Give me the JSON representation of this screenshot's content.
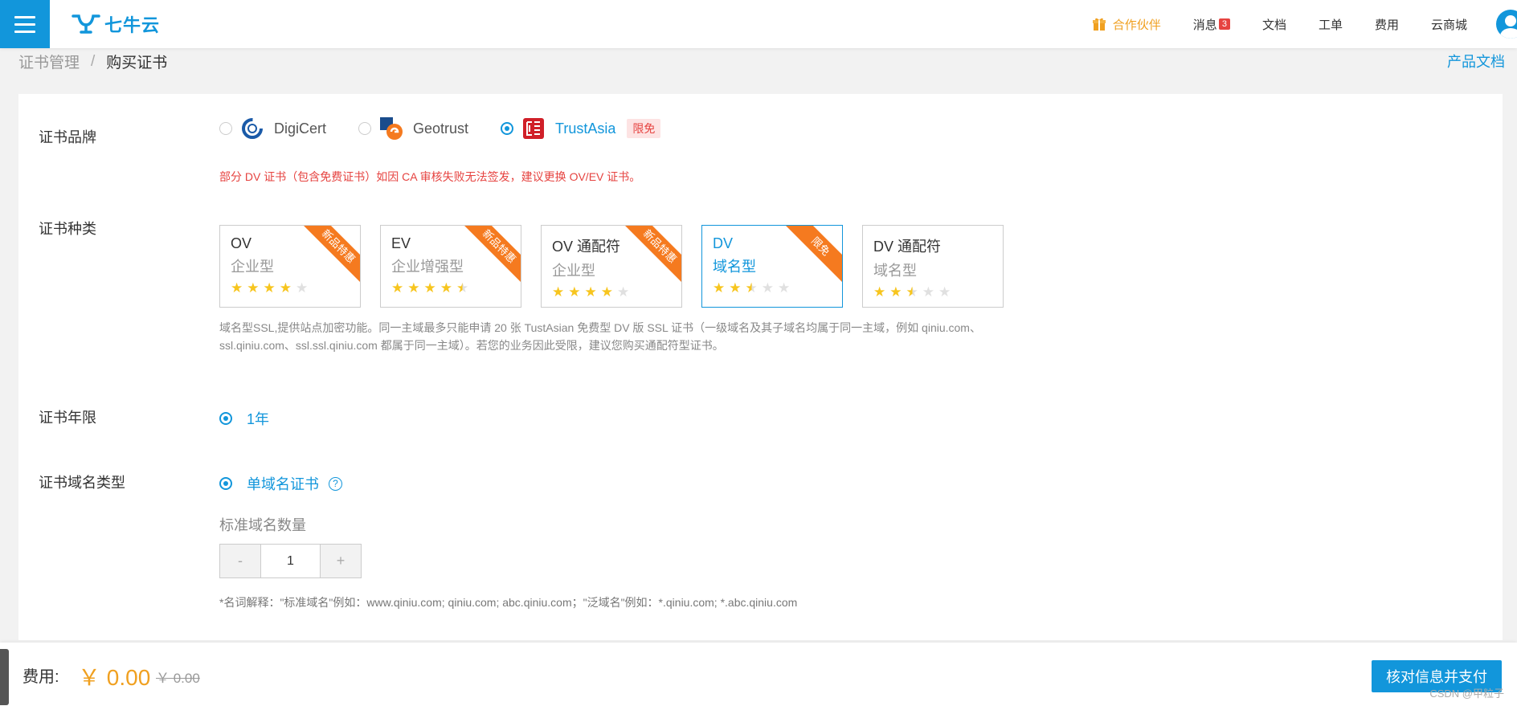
{
  "header": {
    "logo_text": "七牛云",
    "nav": {
      "partner": "合作伙伴",
      "messages": "消息",
      "messages_count": "3",
      "docs": "文档",
      "tickets": "工单",
      "billing": "费用",
      "market": "云商城"
    }
  },
  "breadcrumb": {
    "parent": "证书管理",
    "separator": "/",
    "current": "购买证书"
  },
  "product_doc_link": "产品文档",
  "form": {
    "brand": {
      "label": "证书品牌",
      "options": [
        {
          "name": "DigiCert",
          "selected": false
        },
        {
          "name": "Geotrust",
          "selected": false
        },
        {
          "name": "TrustAsia",
          "selected": true,
          "tag": "限免"
        }
      ],
      "warning": "部分 DV 证书（包含免费证书）如因 CA 审核失败无法签发，建议更换 OV/EV 证书。"
    },
    "type": {
      "label": "证书种类",
      "options": [
        {
          "name": "OV",
          "sub": "企业型",
          "ribbon": "新品特惠",
          "rating": 4,
          "selected": false
        },
        {
          "name": "EV",
          "sub": "企业增强型",
          "ribbon": "新品特惠",
          "rating": 4.5,
          "selected": false
        },
        {
          "name": "OV 通配符",
          "sub": "企业型",
          "ribbon": "新品特惠",
          "rating": 4,
          "selected": false
        },
        {
          "name": "DV",
          "sub": "域名型",
          "ribbon": "限免",
          "rating": 2.5,
          "selected": true
        },
        {
          "name": "DV 通配符",
          "sub": "域名型",
          "ribbon": "",
          "rating": 2.5,
          "selected": false
        }
      ],
      "description": "域名型SSL,提供站点加密功能。同一主域最多只能申请 20 张 TustAsian 免费型 DV 版 SSL 证书（一级域名及其子域名均属于同一主域，例如 qiniu.com、ssl.qiniu.com、ssl.ssl.qiniu.com 都属于同一主域）。若您的业务因此受限，建议您购买通配符型证书。"
    },
    "period": {
      "label": "证书年限",
      "option": "1年"
    },
    "domain_type": {
      "label": "证书域名类型",
      "option": "单域名证书",
      "help_icon": "?"
    },
    "quantity": {
      "label": "标准域名数量",
      "minus": "-",
      "value": "1",
      "plus": "+"
    },
    "note": "*名词解释：\"标准域名\"例如：www.qiniu.com; qiniu.com; abc.qiniu.com；\"泛域名\"例如：*.qiniu.com; *.abc.qiniu.com"
  },
  "footer": {
    "fee_label": "费用:",
    "price": "￥ 0.00",
    "original_price": "￥ 0.00",
    "pay_button": "核对信息并支付",
    "watermark": "CSDN @甲粒子"
  },
  "colors": {
    "primary": "#1296db",
    "warning": "#e64340",
    "price": "#f0a020",
    "ribbon": "#f57a1f",
    "star": "#f7c51e"
  }
}
